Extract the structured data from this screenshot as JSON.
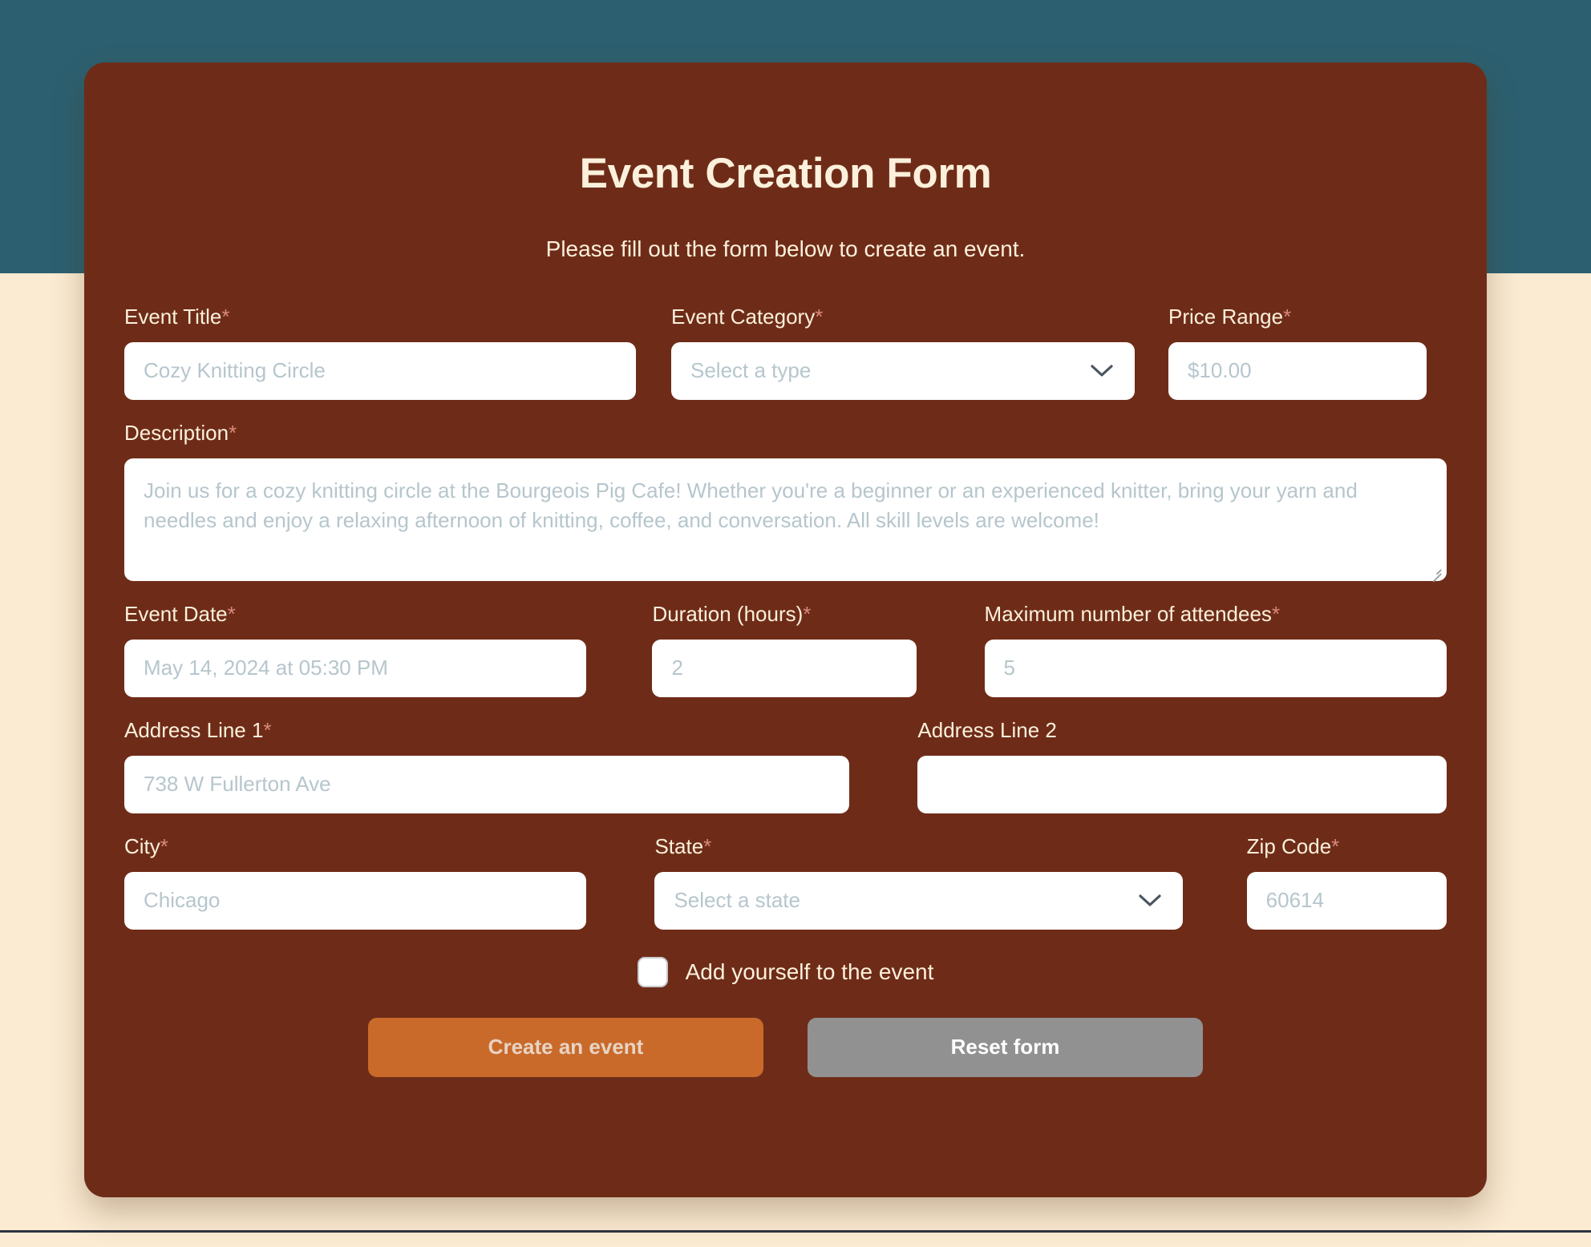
{
  "theme": {
    "header_band": "#2C6070",
    "page_background": "#FBEBD2",
    "card_background": "#6E2C18",
    "label_color": "#FBF0DB",
    "required_asterisk_color": "#D98A7B",
    "placeholder_color": "#B6C6CC",
    "primary_button": "#C96A2B",
    "secondary_button": "#919191"
  },
  "card": {
    "title": "Event Creation Form",
    "subtitle": "Please fill out the form below to create an event."
  },
  "fields": {
    "event_title": {
      "label": "Event Title",
      "required_mark": "*",
      "placeholder": "Cozy Knitting Circle",
      "value": ""
    },
    "event_category": {
      "label": "Event Category",
      "required_mark": "*",
      "selected": "Select a type",
      "value": ""
    },
    "price_range": {
      "label": "Price Range",
      "required_mark": "*",
      "placeholder": "$10.00",
      "value": ""
    },
    "description": {
      "label": "Description",
      "required_mark": "*",
      "placeholder": "Join us for a cozy knitting circle at the Bourgeois Pig Cafe! Whether you're a beginner or an experienced knitter, bring your yarn and needles and enjoy a relaxing afternoon of knitting, coffee, and conversation. All skill levels are welcome!",
      "value": ""
    },
    "event_date": {
      "label": "Event Date",
      "required_mark": "*",
      "placeholder": "May 14, 2024 at 05:30 PM",
      "value": ""
    },
    "duration": {
      "label": "Duration (hours)",
      "required_mark": "*",
      "placeholder": "2",
      "value": ""
    },
    "max_attendees": {
      "label": "Maximum number of attendees",
      "required_mark": "*",
      "placeholder": "5",
      "value": ""
    },
    "address_line_1": {
      "label": "Address Line 1",
      "required_mark": "*",
      "placeholder": "738 W Fullerton Ave",
      "value": ""
    },
    "address_line_2": {
      "label": "Address Line 2",
      "required_mark": "",
      "placeholder": "",
      "value": ""
    },
    "city": {
      "label": "City",
      "required_mark": "*",
      "placeholder": "Chicago",
      "value": ""
    },
    "state": {
      "label": "State",
      "required_mark": "*",
      "selected": "Select a state",
      "value": ""
    },
    "zip_code": {
      "label": "Zip Code",
      "required_mark": "*",
      "placeholder": "60614",
      "value": ""
    }
  },
  "checkbox": {
    "label": "Add yourself to the event",
    "checked": false
  },
  "buttons": {
    "submit_label": "Create an event",
    "reset_label": "Reset form"
  },
  "icons": {
    "chevron_down": "chevron-down-icon",
    "resize_handle": "resize-handle-icon"
  }
}
